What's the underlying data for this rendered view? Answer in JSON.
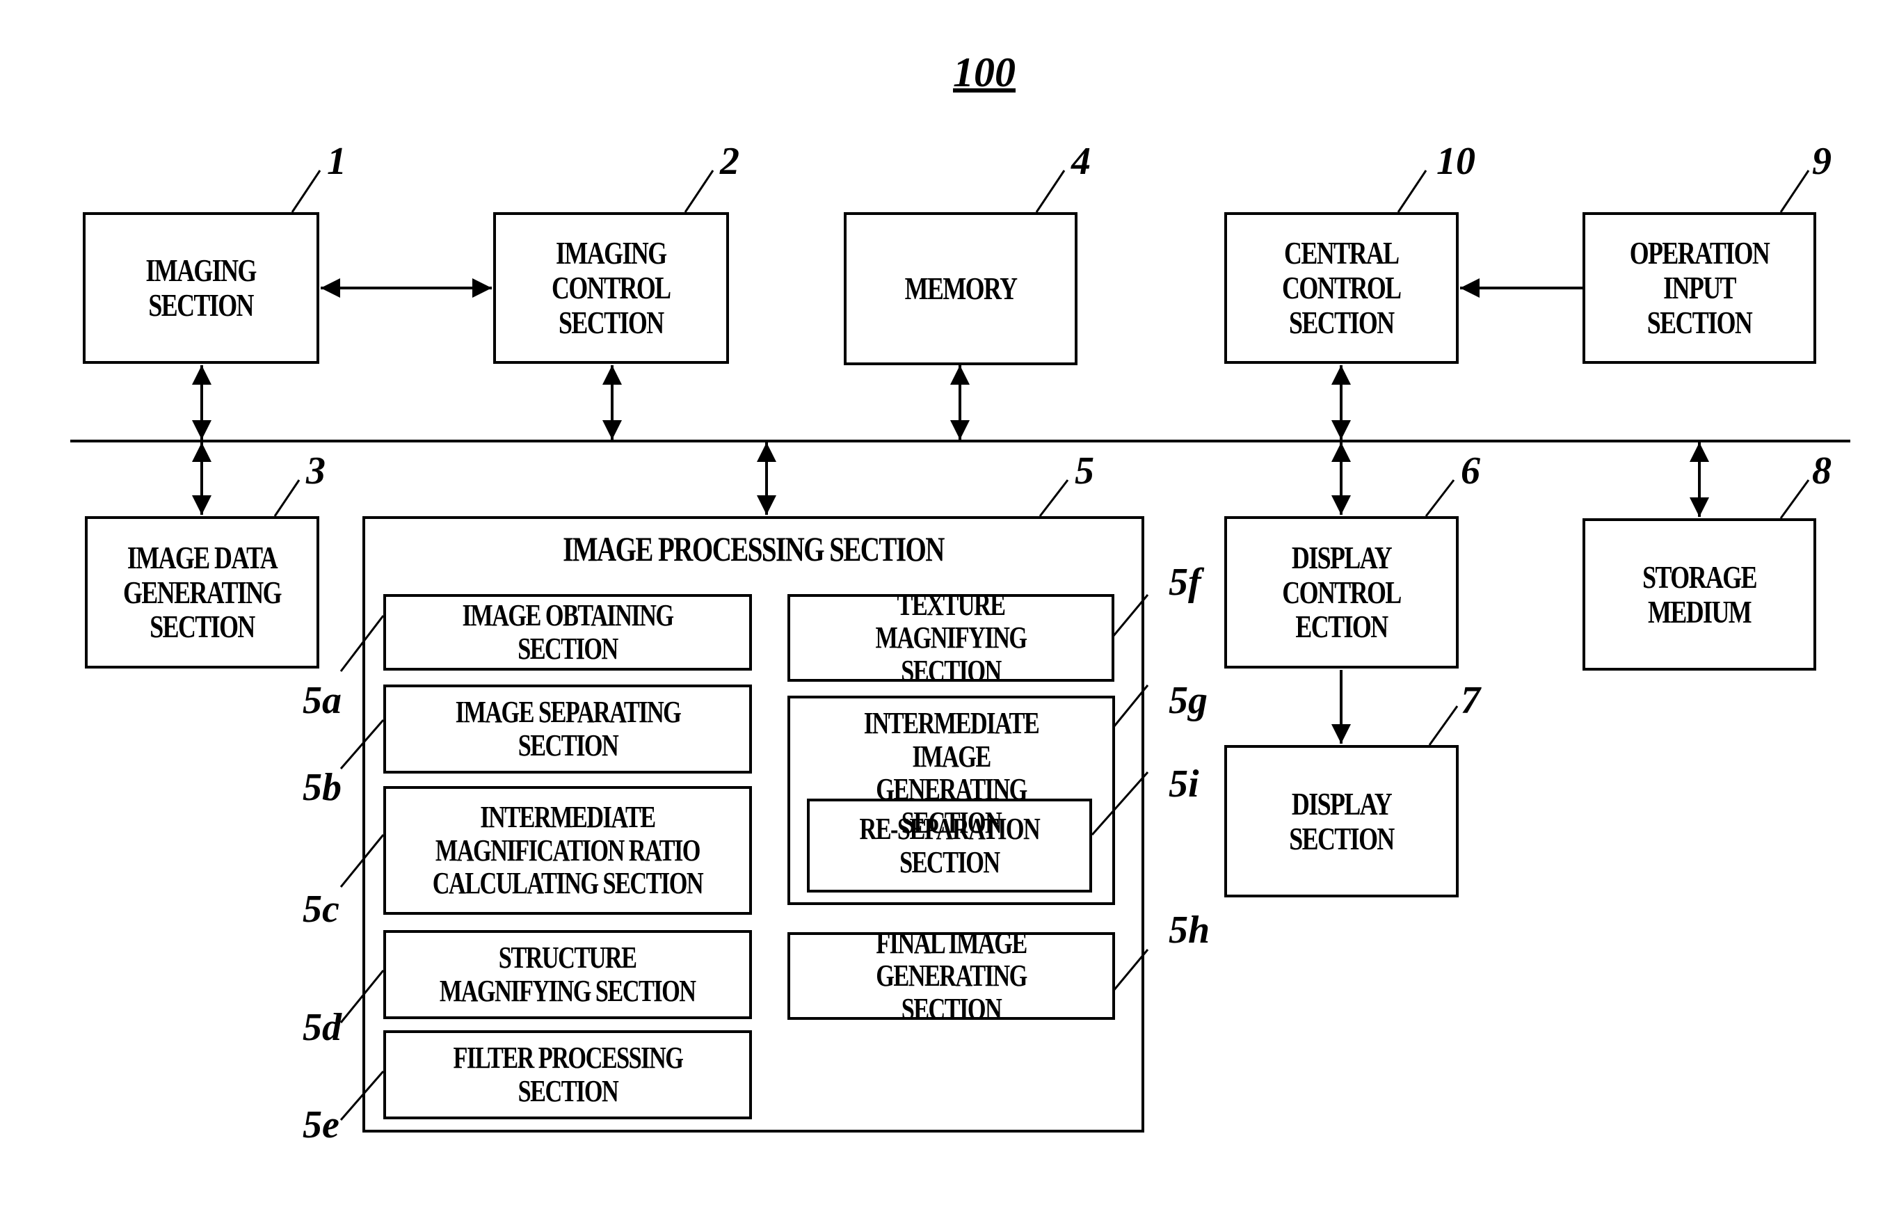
{
  "figure_ref": "100",
  "blocks": {
    "imaging": {
      "ref": "1",
      "label": "IMAGING\nSECTION"
    },
    "imaging_control": {
      "ref": "2",
      "label": "IMAGING\nCONTROL\nSECTION"
    },
    "memory": {
      "ref": "4",
      "label": "MEMORY"
    },
    "central_control": {
      "ref": "10",
      "label": "CENTRAL\nCONTROL\nSECTION"
    },
    "operation_input": {
      "ref": "9",
      "label": "OPERATION\nINPUT SECTION"
    },
    "image_data_generating": {
      "ref": "3",
      "label": "IMAGE DATA\nGENERATING\nSECTION"
    },
    "image_processing": {
      "ref": "5",
      "label": "IMAGE PROCESSING SECTION"
    },
    "display_control": {
      "ref": "6",
      "label": "DISPLAY\nCONTROL ECTION"
    },
    "storage_medium": {
      "ref": "8",
      "label": "STORAGE\nMEDIUM"
    },
    "display": {
      "ref": "7",
      "label": "DISPLAY SECTION"
    }
  },
  "sub_blocks": {
    "5a": {
      "ref": "5a",
      "label": "IMAGE OBTAINING SECTION"
    },
    "5b": {
      "ref": "5b",
      "label": "IMAGE SEPARATING\nSECTION"
    },
    "5c": {
      "ref": "5c",
      "label": "INTERMEDIATE\nMAGNIFICATION RATIO\nCALCULATING SECTION"
    },
    "5d": {
      "ref": "5d",
      "label": "STRUCTURE\nMAGNIFYING SECTION"
    },
    "5e": {
      "ref": "5e",
      "label": "FILTER PROCESSING\nSECTION"
    },
    "5f": {
      "ref": "5f",
      "label": "TEXTURE MAGNIFYING\nSECTION"
    },
    "5g": {
      "ref": "5g",
      "label": "INTERMEDIATE IMAGE\nGENERATING SECTION"
    },
    "5i": {
      "ref": "5i",
      "label": "RE-SEPARATION\nSECTION"
    },
    "5h": {
      "ref": "5h",
      "label": "FINAL IMAGE\nGENERATING SECTION"
    }
  }
}
